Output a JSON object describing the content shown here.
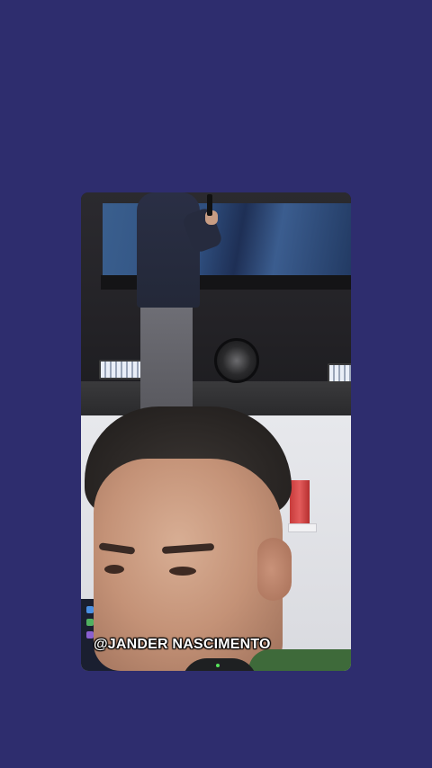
{
  "video": {
    "caption": "@JANDER NASCIMENTO"
  },
  "colors": {
    "page_background": "#2e2d6e",
    "caption_text": "#ffffff"
  }
}
